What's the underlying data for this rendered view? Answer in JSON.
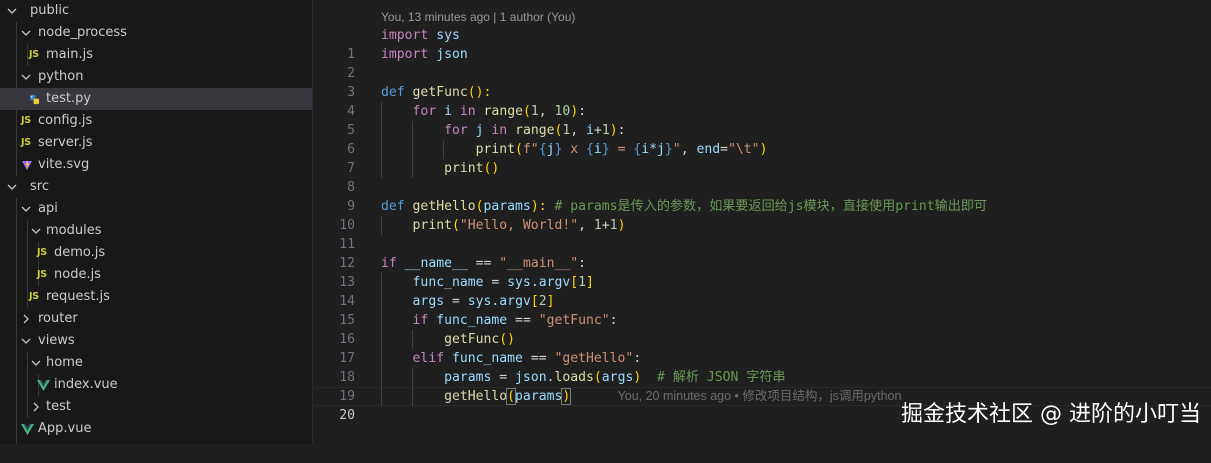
{
  "explorer": {
    "items": [
      {
        "label": "public",
        "kind": "folder",
        "open": true,
        "depth": 0
      },
      {
        "label": "node_process",
        "kind": "folder",
        "open": true,
        "depth": 1
      },
      {
        "label": "main.js",
        "kind": "js",
        "depth": 2
      },
      {
        "label": "python",
        "kind": "folder",
        "open": true,
        "depth": 1
      },
      {
        "label": "test.py",
        "kind": "py",
        "depth": 2,
        "selected": true
      },
      {
        "label": "config.js",
        "kind": "js",
        "depth": 1
      },
      {
        "label": "server.js",
        "kind": "js",
        "depth": 1
      },
      {
        "label": "vite.svg",
        "kind": "svg",
        "depth": 1
      },
      {
        "label": "src",
        "kind": "folder",
        "open": true,
        "depth": 0
      },
      {
        "label": "api",
        "kind": "folder",
        "open": true,
        "depth": 1
      },
      {
        "label": "modules",
        "kind": "folder",
        "open": true,
        "depth": 2
      },
      {
        "label": "demo.js",
        "kind": "js",
        "depth": 3
      },
      {
        "label": "node.js",
        "kind": "js",
        "depth": 3
      },
      {
        "label": "request.js",
        "kind": "js",
        "depth": 2
      },
      {
        "label": "router",
        "kind": "folder",
        "open": false,
        "depth": 1
      },
      {
        "label": "views",
        "kind": "folder",
        "open": true,
        "depth": 1
      },
      {
        "label": "home",
        "kind": "folder",
        "open": true,
        "depth": 2
      },
      {
        "label": "index.vue",
        "kind": "vue",
        "depth": 3
      },
      {
        "label": "test",
        "kind": "folder",
        "open": false,
        "depth": 2
      },
      {
        "label": "App.vue",
        "kind": "vue",
        "depth": 1
      }
    ],
    "js_badge": "JS"
  },
  "editor": {
    "blame_header": "You, 13 minutes ago | 1 author (You)",
    "lines": [
      {
        "n": "1"
      },
      {
        "n": "2"
      },
      {
        "n": "3"
      },
      {
        "n": "4"
      },
      {
        "n": "5"
      },
      {
        "n": "6"
      },
      {
        "n": "7"
      },
      {
        "n": "8"
      },
      {
        "n": "9"
      },
      {
        "n": "10"
      },
      {
        "n": "11"
      },
      {
        "n": "12"
      },
      {
        "n": "13"
      },
      {
        "n": "14"
      },
      {
        "n": "15"
      },
      {
        "n": "16"
      },
      {
        "n": "17"
      },
      {
        "n": "18"
      },
      {
        "n": "19"
      },
      {
        "n": "20"
      }
    ],
    "code": {
      "l1": {
        "kw": "import",
        "rest": " sys"
      },
      "l2": {
        "kw": "import",
        "rest": " json"
      },
      "l4": {
        "def": "def",
        "fn": "getFunc",
        "tail": "():"
      },
      "l5": {
        "for": "for",
        "i": "i",
        "in": "in",
        "fn": "range",
        "a": "1",
        "b": "10",
        "tail": ":"
      },
      "l6": {
        "for": "for",
        "j": "j",
        "in": "in",
        "fn": "range",
        "a": "1",
        "i": "i",
        "b": "1",
        "tail": ":"
      },
      "l7": {
        "fn": "print",
        "fpre": "f\"",
        "j": "j",
        "x": " x ",
        "i": "i",
        "eq": " = ",
        "ij": "i*j",
        "fend": "\"",
        "end_kw": "end",
        "end_val": "\"\\t\""
      },
      "l8": {
        "fn": "print",
        "tail": "()"
      },
      "l10": {
        "def": "def",
        "fn": "getHello",
        "param": "params",
        "tail": "):",
        "comment": " # params是传入的参数，如果要返回给js模块，直接使用print输出即可"
      },
      "l11": {
        "fn": "print",
        "str": "\"Hello, World!\"",
        "a": "1",
        "b": "1"
      },
      "l13": {
        "if": "if",
        "name": "__name__",
        "op": " == ",
        "str": "\"__main__\"",
        "tail": ":"
      },
      "l14": {
        "var": "func_name",
        "op": " = ",
        "mod": "sys",
        "attr": "argv",
        "idx": "1"
      },
      "l15": {
        "var": "args",
        "op": " = ",
        "mod": "sys",
        "attr": "argv",
        "idx": "2"
      },
      "l16": {
        "if": "if",
        "var": "func_name",
        "op": " == ",
        "str": "\"getFunc\"",
        "tail": ":"
      },
      "l17": {
        "fn": "getFunc",
        "tail": "()"
      },
      "l18": {
        "elif": "elif",
        "var": "func_name",
        "op": " == ",
        "str": "\"getHello\"",
        "tail": ":"
      },
      "l19": {
        "var": "params",
        "op": " = ",
        "mod": "json",
        "fn": "loads",
        "arg": "args",
        "comment": "  # 解析 JSON 字符串"
      },
      "l20": {
        "fn": "getHello",
        "arg": "params",
        "ghost": "You, 20 minutes ago • 修改项目结构，js调用python"
      }
    }
  },
  "watermark": "掘金技术社区 @ 进阶的小叮当",
  "colors": {
    "bg": "#1f1f1f",
    "sidebar": "#181818",
    "selected": "#37373d",
    "js": "#cbcb41",
    "vue": "#41b883",
    "python": "#3b82c4"
  }
}
